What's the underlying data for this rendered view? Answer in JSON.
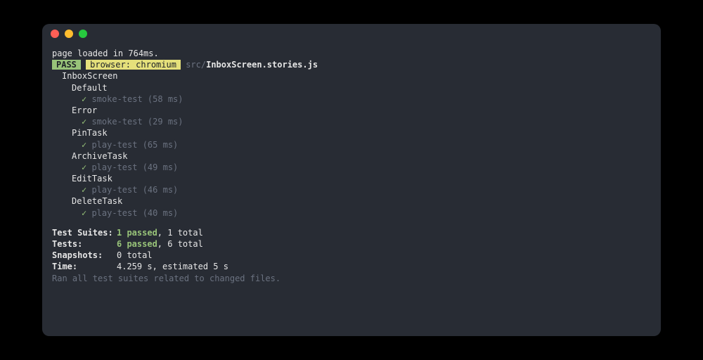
{
  "loaded_line": "page loaded in 764ms.",
  "pass_label": "PASS",
  "browser_label": "browser: chromium",
  "path_prefix": "src/",
  "file_name": "InboxScreen.stories.js",
  "suite_name": "InboxScreen",
  "tests": [
    {
      "name": "Default",
      "test": "smoke-test",
      "ms": "58 ms"
    },
    {
      "name": "Error",
      "test": "smoke-test",
      "ms": "29 ms"
    },
    {
      "name": "PinTask",
      "test": "play-test",
      "ms": "65 ms"
    },
    {
      "name": "ArchiveTask",
      "test": "play-test",
      "ms": "49 ms"
    },
    {
      "name": "EditTask",
      "test": "play-test",
      "ms": "46 ms"
    },
    {
      "name": "DeleteTask",
      "test": "play-test",
      "ms": "40 ms"
    }
  ],
  "summary": {
    "suites_label": "Test Suites:",
    "suites_passed": "1 passed",
    "suites_total": ", 1 total",
    "tests_label": "Tests:",
    "tests_passed": "6 passed",
    "tests_total": ", 6 total",
    "snapshots_label": "Snapshots:",
    "snapshots_value": "0 total",
    "time_label": "Time:",
    "time_value": "4.259 s, estimated 5 s"
  },
  "footer": "Ran all test suites related to changed files."
}
